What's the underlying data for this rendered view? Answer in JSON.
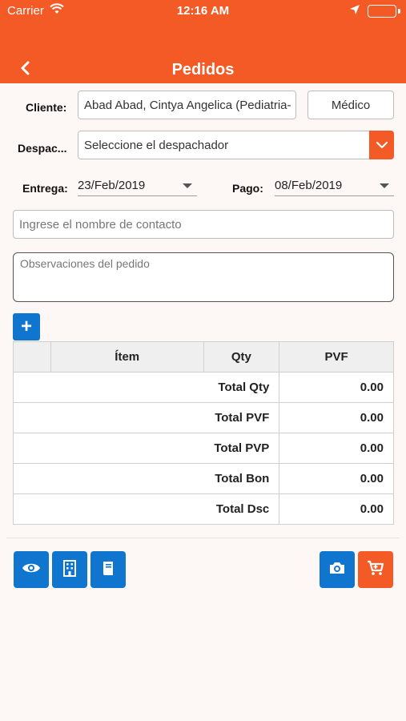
{
  "statusbar": {
    "carrier": "Carrier",
    "time": "12:16 AM"
  },
  "navbar": {
    "title": "Pedidos"
  },
  "form": {
    "cliente_label": "Cliente:",
    "cliente_value": "Abad Abad, Cintya Angelica (Pediatria-",
    "medico_button": "Médico",
    "despachador_label": "Despac...",
    "despachador_value": "Seleccione el despachador",
    "entrega_label": "Entrega:",
    "entrega_value": "23/Feb/2019",
    "pago_label": "Pago:",
    "pago_value": "08/Feb/2019",
    "contacto_placeholder": "Ingrese el nombre de contacto",
    "observaciones_placeholder": "Observaciones del pedido"
  },
  "table": {
    "headers": [
      "",
      "Ítem",
      "Qty",
      "PVF"
    ],
    "totals": [
      {
        "label": "Total Qty",
        "value": "0.00"
      },
      {
        "label": "Total PVF",
        "value": "0.00"
      },
      {
        "label": "Total PVP",
        "value": "0.00"
      },
      {
        "label": "Total Bon",
        "value": "0.00"
      },
      {
        "label": "Total Dsc",
        "value": "0.00"
      }
    ]
  },
  "add_button": "+",
  "colors": {
    "primary": "#f45a25",
    "accent_blue": "#1075cf"
  },
  "icons": [
    "wifi-icon",
    "location-arrow-icon",
    "battery-icon",
    "back-chevron-icon",
    "chevron-down-icon",
    "eye-icon",
    "building-icon",
    "book-icon",
    "camera-icon",
    "cart-icon"
  ]
}
